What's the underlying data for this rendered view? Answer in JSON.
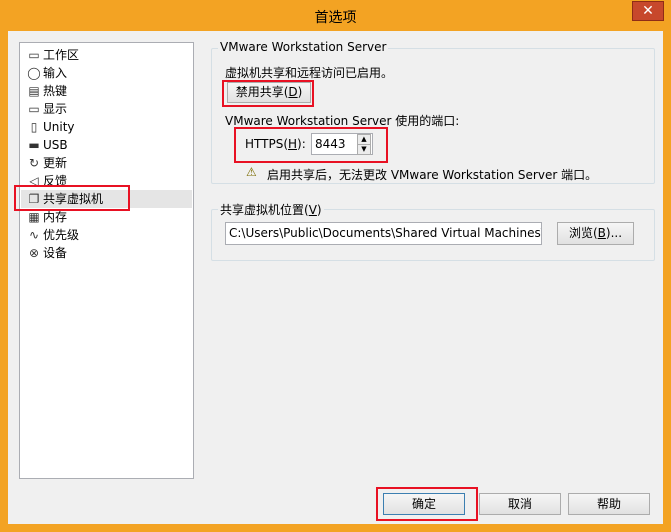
{
  "window": {
    "title": "首选项",
    "close_label": "✕"
  },
  "sidebar": {
    "items": [
      {
        "label": "工作区",
        "icon": "workspace-icon",
        "glyph": "▭"
      },
      {
        "label": "输入",
        "icon": "mouse-icon",
        "glyph": "◯"
      },
      {
        "label": "热键",
        "icon": "hotkey-icon",
        "glyph": "▤"
      },
      {
        "label": "显示",
        "icon": "monitor-icon",
        "glyph": "▭"
      },
      {
        "label": "Unity",
        "icon": "unity-icon",
        "glyph": "▯"
      },
      {
        "label": "USB",
        "icon": "usb-icon",
        "glyph": "▬"
      },
      {
        "label": "更新",
        "icon": "refresh-icon",
        "glyph": "↻"
      },
      {
        "label": "反馈",
        "icon": "feedback-icon",
        "glyph": "◁"
      },
      {
        "label": "共享虚拟机",
        "icon": "shared-vm-icon",
        "glyph": "❐"
      },
      {
        "label": "内存",
        "icon": "memory-icon",
        "glyph": "▦"
      },
      {
        "label": "优先级",
        "icon": "priority-icon",
        "glyph": "∿"
      },
      {
        "label": "设备",
        "icon": "device-icon",
        "glyph": "⊗"
      }
    ],
    "selected_index": 8
  },
  "server_group": {
    "title": "VMware Workstation Server",
    "status_text": "虚拟机共享和远程访问已启用。",
    "disable_button": {
      "label": "禁用共享(",
      "key": "D",
      "end": ")"
    },
    "port_label": "VMware Workstation Server 使用的端口:",
    "https_label": {
      "label": "HTTPS(",
      "key": "H",
      "end": "):"
    },
    "port_value": "8443",
    "warning_icon": "⚠",
    "warning_text": "启用共享后，无法更改 VMware Workstation Server 端口。"
  },
  "location_group": {
    "title": {
      "label": "共享虚拟机位置(",
      "key": "V",
      "end": ")"
    },
    "path": "C:\\Users\\Public\\Documents\\Shared Virtual Machines\\",
    "browse_button": {
      "label": "浏览(",
      "key": "B",
      "end": ")..."
    }
  },
  "footer": {
    "ok_label": "确定",
    "cancel_label": "取消",
    "help_label": "帮助"
  }
}
